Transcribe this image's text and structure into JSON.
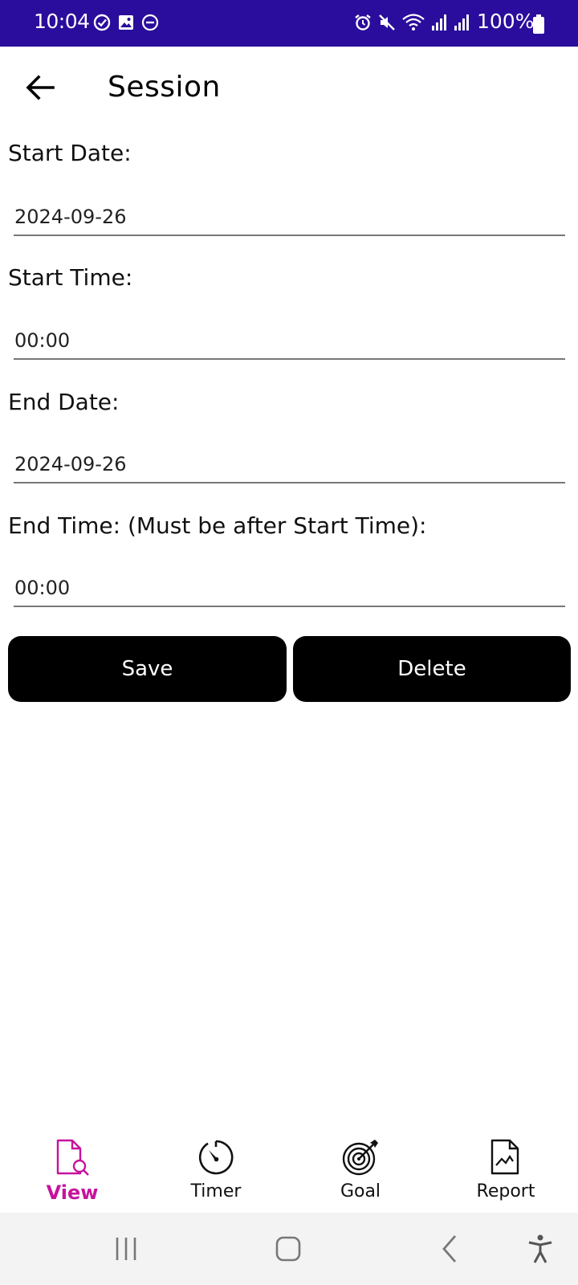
{
  "status_bar": {
    "time": "10:04",
    "battery": "100%",
    "left_icons": [
      "check-circle-icon",
      "image-icon",
      "do-not-disturb-icon"
    ],
    "right_icons": [
      "alarm-icon",
      "mute-icon",
      "wifi-icon",
      "signal-icon",
      "signal-icon",
      "battery-icon"
    ]
  },
  "header": {
    "title": "Session"
  },
  "form": {
    "start_date_label": "Start Date:",
    "start_date_value": "2024-09-26",
    "start_time_label": "Start Time:",
    "start_time_value": "00:00",
    "end_date_label": "End Date:",
    "end_date_value": "2024-09-26",
    "end_time_label": "End Time: (Must be after Start Time):",
    "end_time_value": "00:00",
    "save_label": "Save",
    "delete_label": "Delete"
  },
  "bottom_nav": {
    "items": [
      {
        "label": "View",
        "icon": "document-search-icon",
        "active": true
      },
      {
        "label": "Timer",
        "icon": "timer-icon",
        "active": false
      },
      {
        "label": "Goal",
        "icon": "target-icon",
        "active": false
      },
      {
        "label": "Report",
        "icon": "report-chart-icon",
        "active": false
      }
    ]
  },
  "colors": {
    "status_bar": "#2a0d9c",
    "accent": "#c7129d",
    "button": "#000000"
  }
}
